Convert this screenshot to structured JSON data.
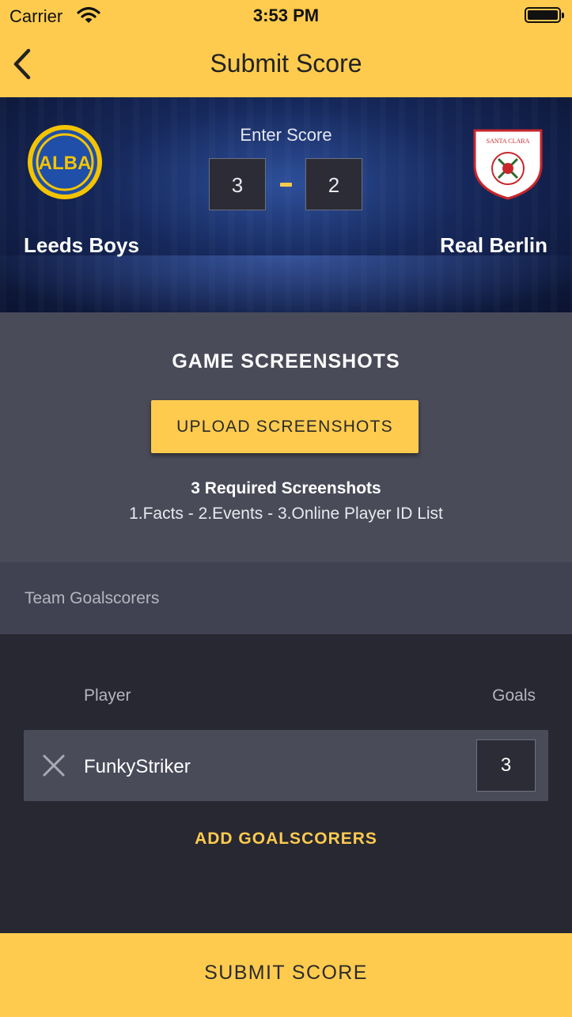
{
  "status_bar": {
    "carrier": "Carrier",
    "time": "3:53 PM"
  },
  "nav": {
    "title": "Submit Score",
    "back_icon": "chevron-left-icon"
  },
  "match": {
    "enter_score_label": "Enter Score",
    "home": {
      "name": "Leeds Boys",
      "score": "3",
      "logo_text": "ALBA"
    },
    "away": {
      "name": "Real Berlin",
      "score": "2",
      "logo_text": "SANTA CLARA"
    }
  },
  "screenshots": {
    "heading": "GAME SCREENSHOTS",
    "upload_button": "UPLOAD SCREENSHOTS",
    "required_title": "3 Required Screenshots",
    "required_list": "1.Facts - 2.Events - 3.Online Player ID List"
  },
  "goalscorers": {
    "section_label": "Team Goalscorers",
    "col_player": "Player",
    "col_goals": "Goals",
    "rows": [
      {
        "player": "FunkyStriker",
        "goals": "3"
      }
    ],
    "add_button": "ADD GOALSCORERS"
  },
  "submit_button": "SUBMIT SCORE",
  "colors": {
    "accent": "#fecb4e",
    "section_bg": "#4a4b59",
    "list_bg": "#282833"
  }
}
